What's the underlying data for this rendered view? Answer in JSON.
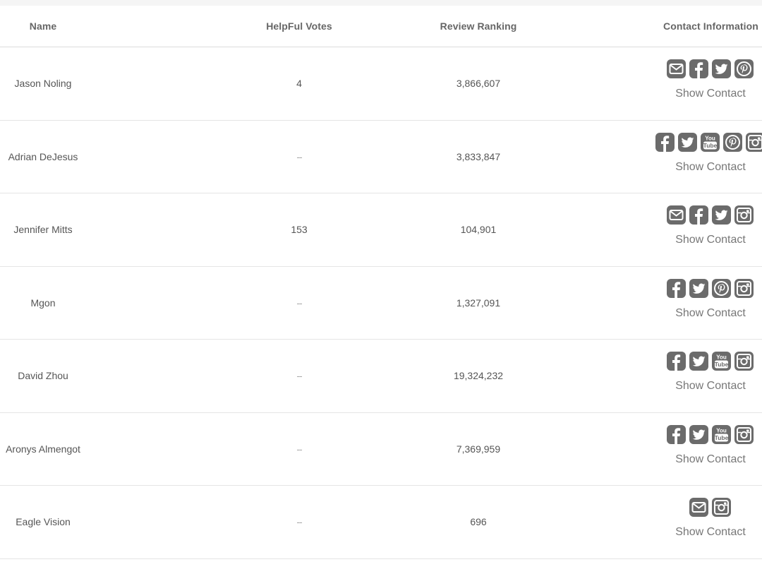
{
  "table": {
    "headers": {
      "name": "Name",
      "votes": "HelpFul Votes",
      "ranking": "Review Ranking",
      "contact": "Contact Information"
    },
    "rows": [
      {
        "name": "Jason Noling",
        "votes": "4",
        "ranking": "3,866,607",
        "icons": [
          "email-icon",
          "facebook-icon",
          "twitter-icon",
          "pinterest-icon"
        ],
        "contact_label": "Show Contact"
      },
      {
        "name": "Adrian DeJesus",
        "votes": "--",
        "ranking": "3,833,847",
        "icons": [
          "facebook-icon",
          "twitter-icon",
          "youtube-icon",
          "pinterest-icon",
          "instagram-icon"
        ],
        "contact_label": "Show Contact"
      },
      {
        "name": "Jennifer Mitts",
        "votes": "153",
        "ranking": "104,901",
        "icons": [
          "email-icon",
          "facebook-icon",
          "twitter-icon",
          "instagram-icon"
        ],
        "contact_label": "Show Contact"
      },
      {
        "name": "Mgon",
        "votes": "--",
        "ranking": "1,327,091",
        "icons": [
          "facebook-icon",
          "twitter-icon",
          "pinterest-icon",
          "instagram-icon"
        ],
        "contact_label": "Show Contact"
      },
      {
        "name": "David Zhou",
        "votes": "--",
        "ranking": "19,324,232",
        "icons": [
          "facebook-icon",
          "twitter-icon",
          "youtube-icon",
          "instagram-icon"
        ],
        "contact_label": "Show Contact"
      },
      {
        "name": "Aronys Almengot",
        "votes": "--",
        "ranking": "7,369,959",
        "icons": [
          "facebook-icon",
          "twitter-icon",
          "youtube-icon",
          "instagram-icon"
        ],
        "contact_label": "Show Contact"
      },
      {
        "name": "Eagle Vision",
        "votes": "--",
        "ranking": "696",
        "icons": [
          "email-icon",
          "instagram-icon"
        ],
        "contact_label": "Show Contact"
      }
    ]
  },
  "colors": {
    "icon": "#6b6b6b",
    "text": "#555555",
    "divider": "#e5e5e5"
  }
}
